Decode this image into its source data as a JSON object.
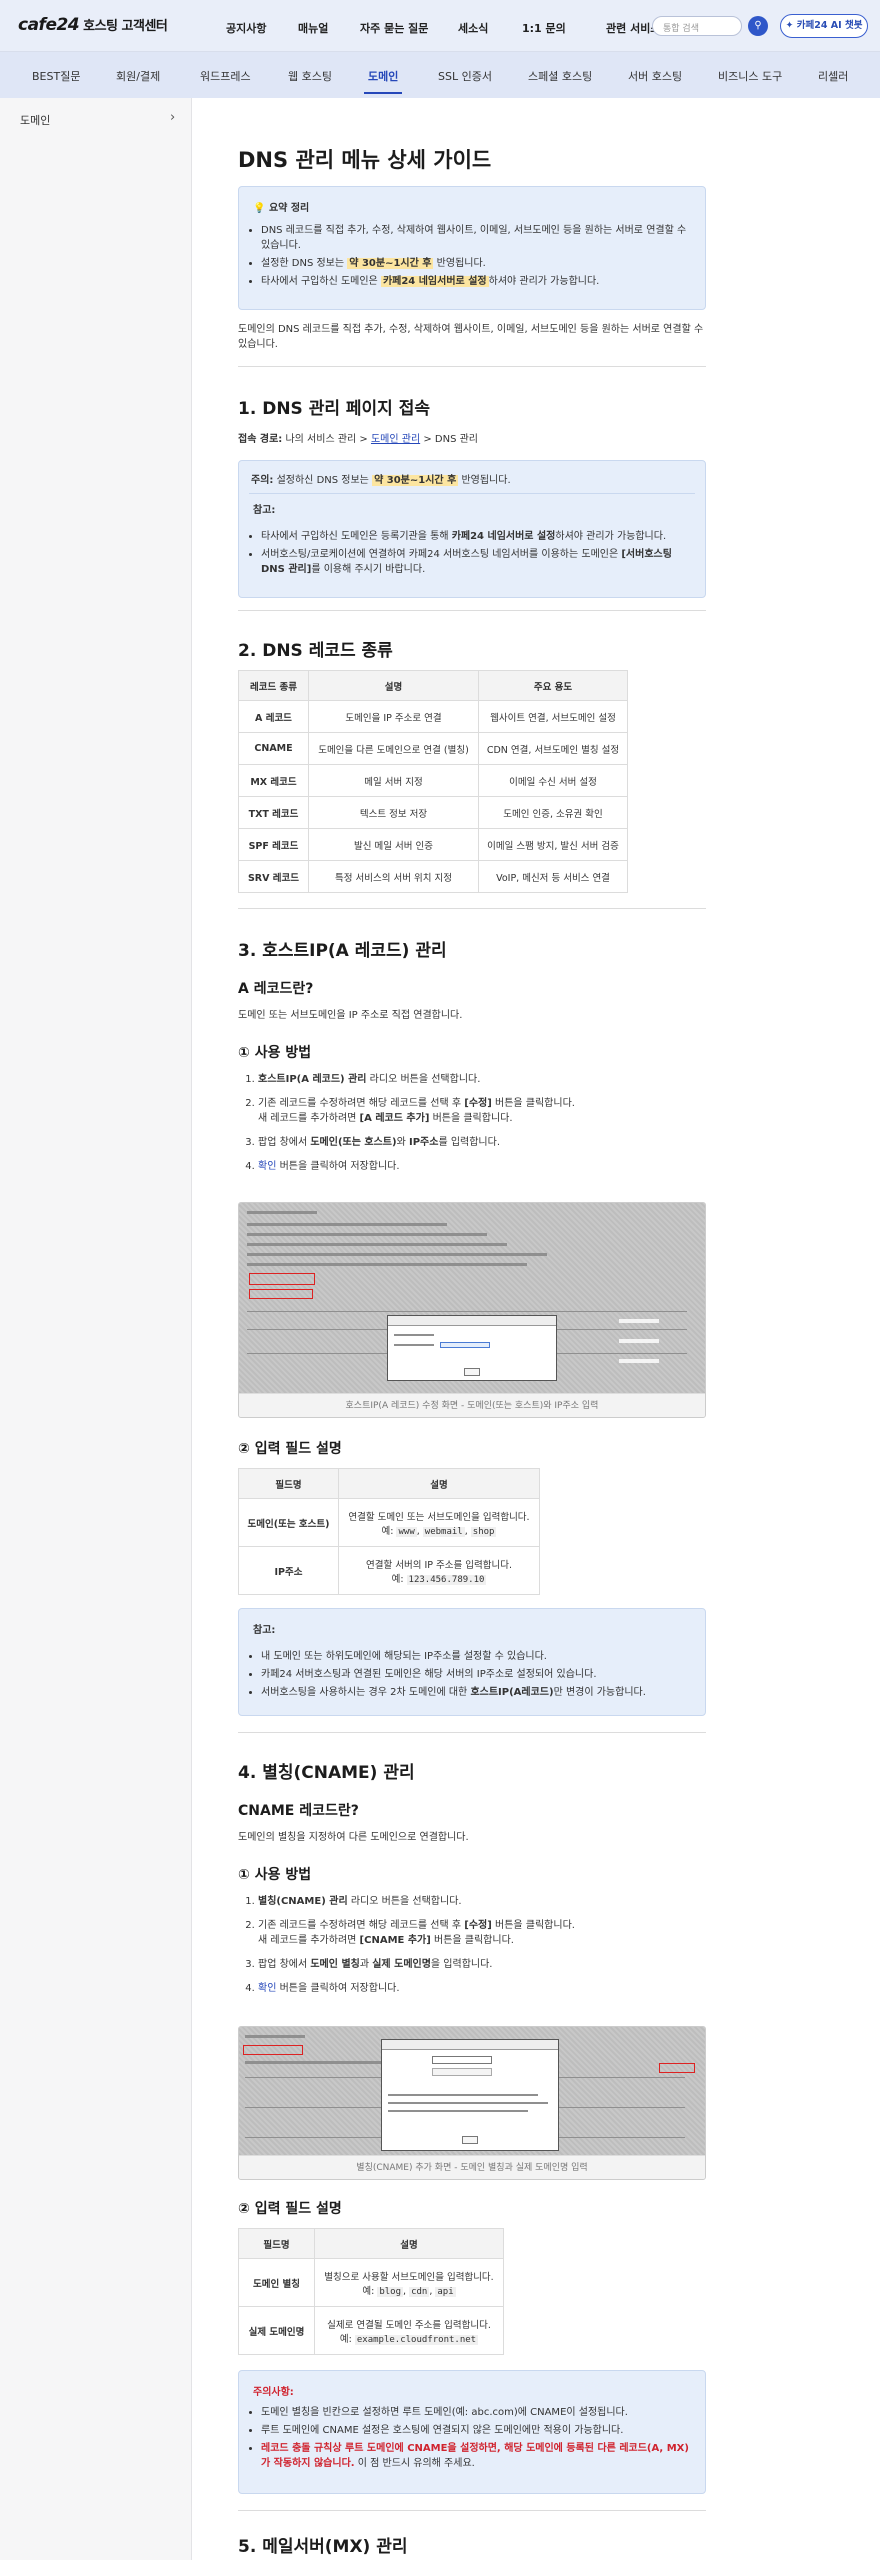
{
  "header": {
    "logo_brand": "cafe24",
    "logo_sub": "호스팅 고객센터",
    "nav": [
      "공지사항",
      "매뉴얼",
      "자주 묻는 질문",
      "세소식",
      "1:1 문의"
    ],
    "related": "관련 서비스",
    "search_placeholder": "통합 검색",
    "ai_button": "카페24 AI 챗봇"
  },
  "tabs": [
    "BEST질문",
    "회원/결제",
    "워드프레스",
    "웹 호스팅",
    "도메인",
    "SSL 인증서",
    "스페셜 호스팅",
    "서버 호스팅",
    "비즈니스 도구",
    "리셀러"
  ],
  "sidebar": {
    "item": "도메인"
  },
  "page": {
    "title": "DNS 관리 메뉴 상세 가이드",
    "summary_title": "요약 정리",
    "summary": {
      "b1": "DNS 레코드를 직접 추가, 수정, 삭제하여 웹사이트, 이메일, 서브도메인 등을 원하는 서버로 연결할 수 있습니다.",
      "b2_pre": "설정한 DNS 정보는 ",
      "b2_hl": "약 30분~1시간 후",
      "b2_post": " 반영됩니다.",
      "b3_pre": "타사에서 구입하신 도메인은 ",
      "b3_hl": "카페24 네임서버로 설정",
      "b3_post": "하셔야 관리가 가능합니다."
    },
    "intro": "도메인의 DNS 레코드를 직접 추가, 수정, 삭제하여 웹사이트, 이메일, 서브도메인 등을 원하는 서버로 연결할 수 있습니다."
  },
  "s1": {
    "title": "1. DNS 관리 페이지 접속",
    "path_label": "접속 경로:",
    "path_pre": " 나의 서비스 관리 > ",
    "path_link": "도메인 관리",
    "path_post": " > DNS 관리",
    "note_label": "주의:",
    "note_pre": " 설정하신 DNS 정보는 ",
    "note_hl": "약 30분~1시간 후",
    "note_post": " 반영됩니다.",
    "ref_label": "참고:",
    "ref1_pre": "타사에서 구입하신 도메인은 등록기관을 통해 ",
    "ref1_b": "카페24 네임서버로 설정",
    "ref1_post": "하셔야 관리가 가능합니다.",
    "ref2_pre": "서버호스팅/코로케이션에 연결하여 카페24 서버호스팅 네임서버를 이용하는 도메인은 ",
    "ref2_b": "[서버호스팅 DNS 관리]",
    "ref2_post": "를 이용해 주시기 바랍니다."
  },
  "s2": {
    "title": "2. DNS 레코드 종류",
    "headers": [
      "레코드 종류",
      "설명",
      "주요 용도"
    ],
    "rows": [
      [
        "A 레코드",
        "도메인을 IP 주소로 연결",
        "웹사이트 연결, 서브도메인 설정"
      ],
      [
        "CNAME",
        "도메인을 다른 도메인으로 연결 (별칭)",
        "CDN 연결, 서브도메인 별칭 설정"
      ],
      [
        "MX 레코드",
        "메일 서버 지정",
        "이메일 수신 서버 설정"
      ],
      [
        "TXT 레코드",
        "텍스트 정보 저장",
        "도메인 인증, 소유권 확인"
      ],
      [
        "SPF 레코드",
        "발신 메일 서버 인증",
        "이메일 스팸 방지, 발신 서버 검증"
      ],
      [
        "SRV 레코드",
        "특정 서비스의 서버 위치 지정",
        "VoIP, 메신저 등 서비스 연결"
      ]
    ]
  },
  "s3": {
    "title": "3. 호스트IP(A 레코드) 관리",
    "sub": "A 레코드란?",
    "desc": "도메인 또는 서브도메인을 IP 주소로 직접 연결합니다.",
    "usage": "① 사용 방법",
    "st1_b": "호스트IP(A 레코드) 관리",
    "st1_post": " 라디오 버튼을 선택합니다.",
    "st2_pre": "기존 레코드를 수정하려면 해당 레코드를 선택 후 ",
    "st2_b": "[수정]",
    "st2_post": " 버튼을 클릭합니다.",
    "st2b_pre": "새 레코드를 추가하려면 ",
    "st2b_b": "[A 레코드 추가]",
    "st2b_post": " 버튼을 클릭합니다.",
    "st3_pre": "팝업 창에서 ",
    "st3_b1": "도메인(또는 호스트)",
    "st3_mid": "와 ",
    "st3_b2": "IP주소",
    "st3_post": "를 입력합니다.",
    "st4_link": "확인",
    "st4_post": " 버튼을 클릭하여 저장합니다.",
    "shot_caption": "호스트IP(A 레코드) 수정 화면 - 도메인(또는 호스트)와 IP주소 입력",
    "fields": "② 입력 필드 설명",
    "f_headers": [
      "필드명",
      "설명"
    ],
    "f1_name": "도메인(또는 호스트)",
    "f1_desc": "연결할 도메인 또는 서브도메인을 입력합니다.",
    "f1_ex": "예: ",
    "f1_c1": "www",
    "f1_c2": "webmail",
    "f1_c3": "shop",
    "f2_name": "IP주소",
    "f2_desc": "연결할 서버의 IP 주소를 입력합니다.",
    "f2_ex": "예: ",
    "f2_c1": "123.456.789.10",
    "ref_label": "참고:",
    "ref1": "내 도메인 또는 하위도메인에 해당되는 IP주소를 설정할 수 있습니다.",
    "ref2": "카페24 서버호스팅과 연결된 도메인은 해당 서버의 IP주소로 설정되어 있습니다.",
    "ref3_pre": "서버호스팅을 사용하시는 경우 2차 도메인에 대한 ",
    "ref3_b": "호스트IP(A레코드)",
    "ref3_post": "만 변경이 가능합니다."
  },
  "s4": {
    "title": "4. 별칭(CNAME) 관리",
    "sub": "CNAME 레코드란?",
    "desc": "도메인의 별칭을 지정하여 다른 도메인으로 연결합니다.",
    "usage": "① 사용 방법",
    "st1_b": "별칭(CNAME) 관리",
    "st1_post": " 라디오 버튼을 선택합니다.",
    "st2_pre": "기존 레코드를 수정하려면 해당 레코드를 선택 후 ",
    "st2_b": "[수정]",
    "st2_post": " 버튼을 클릭합니다.",
    "st2b_pre": "새 레코드를 추가하려면 ",
    "st2b_b": "[CNAME 추가]",
    "st2b_post": " 버튼을 클릭합니다.",
    "st3_pre": "팝업 창에서 ",
    "st3_b1": "도메인 별칭",
    "st3_mid": "과 ",
    "st3_b2": "실제 도메인명",
    "st3_post": "을 입력합니다.",
    "st4_link": "확인",
    "st4_post": " 버튼을 클릭하여 저장합니다.",
    "shot_caption": "별칭(CNAME) 추가 화면 - 도메인 별칭과 실제 도메인명 입력",
    "fields": "② 입력 필드 설명",
    "f_headers": [
      "필드명",
      "설명"
    ],
    "f1_name": "도메인 별칭",
    "f1_desc": "별칭으로 사용할 서브도메인을 입력합니다.",
    "f1_ex": "예: ",
    "f1_c1": "blog",
    "f1_c2": "cdn",
    "f1_c3": "api",
    "f2_name": "실제 도메인명",
    "f2_desc": "실제로 연결될 도메인 주소를 입력합니다.",
    "f2_ex": "예: ",
    "f2_c1": "example.cloudfront.net",
    "warn_label": "주의사항:",
    "w1": "도메인 별칭을 빈칸으로 설정하면 루트 도메인(예: abc.com)에 CNAME이 설정됩니다.",
    "w2": "루트 도메인에 CNAME 설정은 호스팅에 연결되지 않은 도메인에만 적용이 가능합니다.",
    "w3_red": "레코드 충돌 규칙상 루트 도메인에 CNAME을 설정하면, 해당 도메인에 등록된 다른 레코드(A, MX)가 작동하지 않습니다.",
    "w3_post": " 이 점 반드시 유의해 주세요."
  },
  "s5": {
    "title": "5. 메일서버(MX) 관리"
  }
}
